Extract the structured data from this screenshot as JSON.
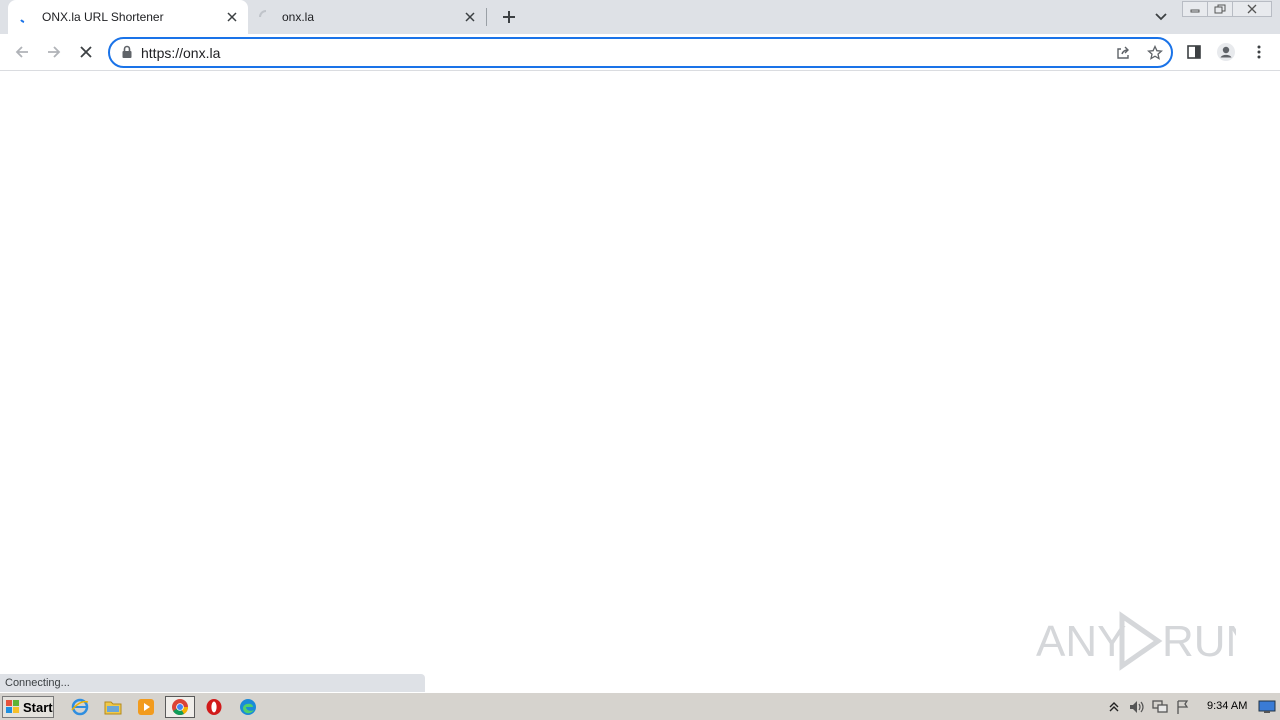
{
  "browser": {
    "tabs": [
      {
        "title": "ONX.la URL Shortener",
        "active": true,
        "loading": true
      },
      {
        "title": "onx.la",
        "active": false,
        "loading": true
      }
    ],
    "address_bar": {
      "url": "https://onx.la"
    },
    "status_text": "Connecting..."
  },
  "watermark": {
    "text": "ANY RUN"
  },
  "taskbar": {
    "start_label": "Start",
    "apps": [
      "internet-explorer-icon",
      "file-explorer-icon",
      "media-player-icon",
      "chrome-icon",
      "opera-icon",
      "edge-icon"
    ],
    "clock": "9:34 AM"
  },
  "colors": {
    "accent": "#1a73e8",
    "tabstrip": "#dee1e6",
    "taskbar": "#d6d3ce"
  }
}
